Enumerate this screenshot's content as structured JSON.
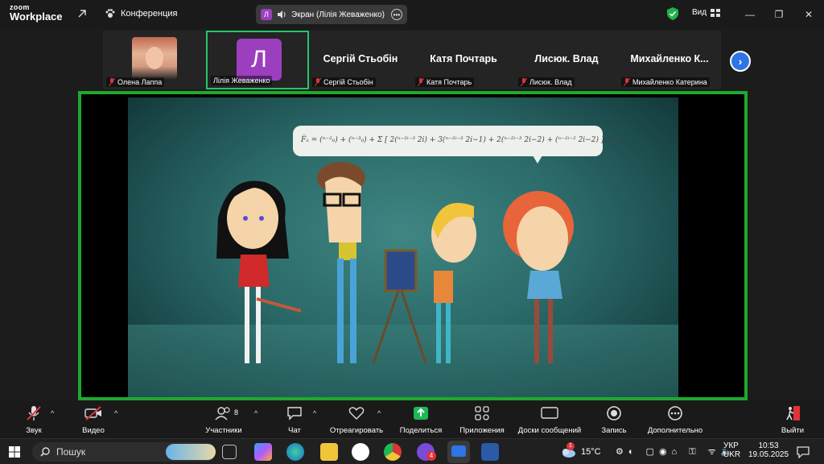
{
  "titlebar": {
    "logo_line1": "zoom",
    "logo_line2": "Workplace",
    "conference_label": "Конференция",
    "share_avatar_letter": "Л",
    "share_label": "Экран (Лілія Жеваженко)",
    "view_label": "Вид"
  },
  "gallery": {
    "tiles": [
      {
        "name": "Олена Лаппа",
        "big": ""
      },
      {
        "name": "Лілія Жеваженко",
        "big": "",
        "avatar": "Л"
      },
      {
        "name": "Сергій Стьобін",
        "big": "Сергій Стьобін"
      },
      {
        "name": "Катя Почтарь",
        "big": "Катя Почтарь"
      },
      {
        "name": "Лисюк. Влад",
        "big": "Лисюк. Влад"
      },
      {
        "name": "Михайленко Катерина",
        "big": "Михайленко  К..."
      }
    ]
  },
  "share": {
    "formula": "F̅ₙ = (ⁿ⁻²₀) + (ⁿ⁻³₀) + Σ [ 2(ⁿ⁻²ⁱ⁻³ 2i) + 3(ⁿ⁻²ⁱ⁻³ 2i−1) + 2(ⁿ⁻²ⁱ⁻³ 2i−2) + (ⁿ⁻²ⁱ⁻² 2i−2) ]   (31)"
  },
  "toolbar": {
    "audio": "Звук",
    "video": "Видео",
    "participants": "Участники",
    "participants_count": "8",
    "chat": "Чат",
    "react": "Отреагировать",
    "share": "Поделиться",
    "apps": "Приложения",
    "whiteboards": "Доски сообщений",
    "record": "Запись",
    "more": "Дополнительно",
    "leave": "Выйти"
  },
  "taskbar": {
    "search_placeholder": "Пошук",
    "notification_count": "4",
    "weather_alert": "1",
    "temperature": "15°C",
    "lang_line1": "УКР",
    "lang_line2": "UKR",
    "time": "10:53",
    "date": "19.05.2025"
  },
  "colors": {
    "active_speaker": "#1fa82e",
    "avatar_purple": "#9c3fbf",
    "share_green": "#1db954",
    "leave_red": "#e0333a"
  }
}
